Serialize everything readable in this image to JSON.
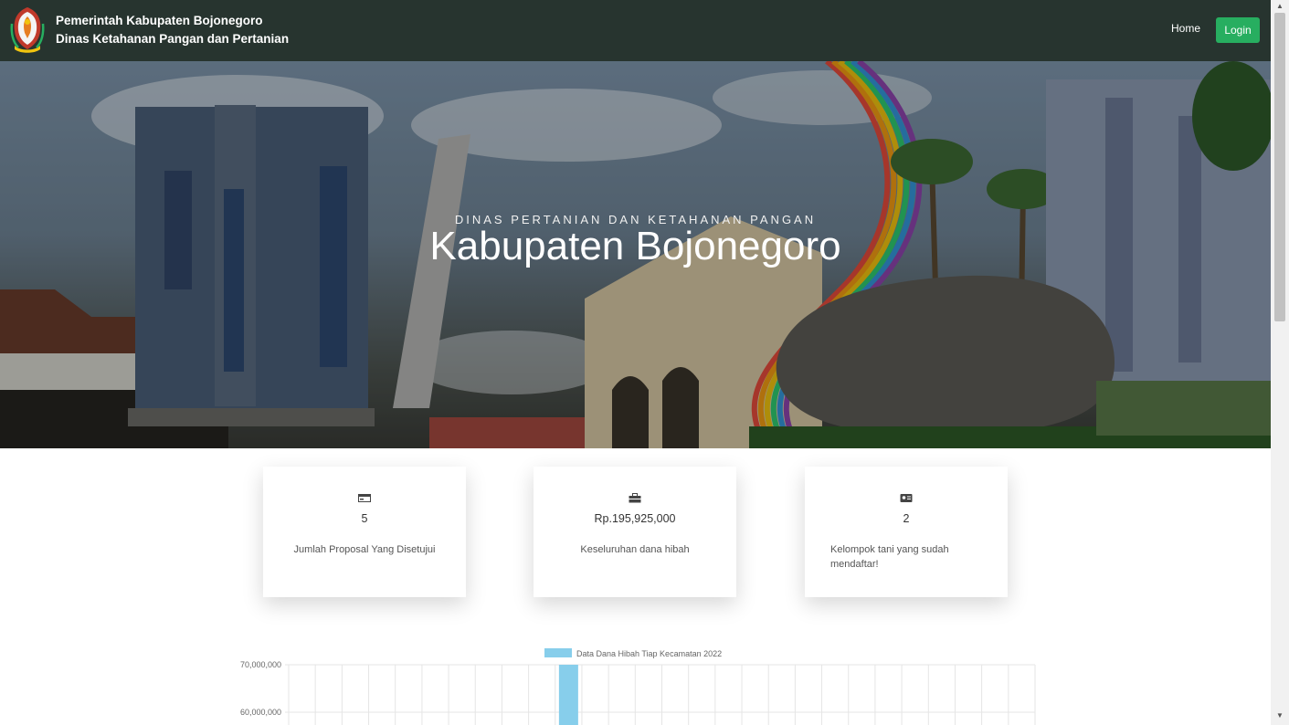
{
  "header": {
    "brand_line1": "Pemerintah Kabupaten Bojonegoro",
    "brand_line2": "Dinas Ketahanan Pangan dan Pertanian",
    "nav_home": "Home",
    "nav_login": "Login"
  },
  "hero": {
    "subtitle": "DINAS PERTANIAN DAN KETAHANAN PANGAN",
    "title": "Kabupaten Bojonegoro"
  },
  "stats": [
    {
      "icon": "money-bill-icon",
      "value": "5",
      "label": "Jumlah Proposal Yang Disetujui"
    },
    {
      "icon": "toolbox-icon",
      "value": "Rp.195,925,000",
      "label": "Keseluruhan dana hibah"
    },
    {
      "icon": "id-card-icon",
      "value": "2",
      "label": "Kelompok tani yang sudah mendaftar!"
    }
  ],
  "colors": {
    "navbar": "#27342f",
    "login_button": "#27ae60",
    "bar": "#87ceeb"
  },
  "chart_data": {
    "type": "bar",
    "series": [
      {
        "name": "Data Dana Hibah Tiap Kecamatan 2022"
      }
    ],
    "y_ticks": [
      "70,000,000",
      "60,000,000"
    ],
    "bar_visible_value_min": 60000000,
    "bar_visible_value_max": 70000000,
    "visible_bar_category_index": 10,
    "category_count": 28,
    "ylim_visible": [
      60000000,
      70000000
    ],
    "grid": true,
    "legend": "top"
  }
}
